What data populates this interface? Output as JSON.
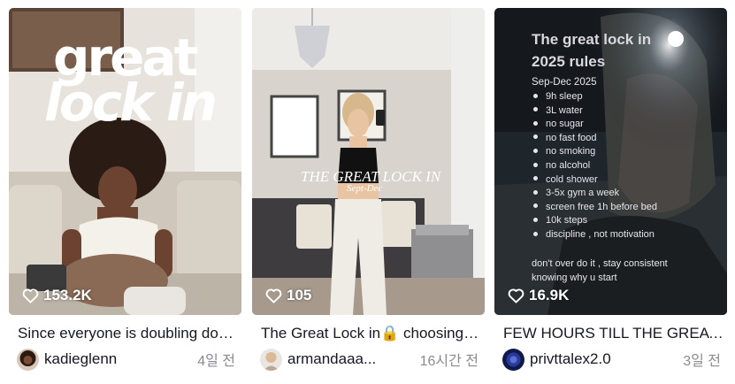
{
  "videos": [
    {
      "likes": "153.2K",
      "title": "Since everyone is doubling down on the great lock in",
      "username": "kadieglenn",
      "time": "4일 전",
      "overlay": {
        "line1": "great",
        "line2": "lock in"
      }
    },
    {
      "likes": "105",
      "title": "The Great Lock in🔒 choosing myself",
      "username": "armandaaa...",
      "time": "16시간 전",
      "overlay": {
        "line1": "THE GREAT LOCK IN",
        "line2": "Sept-Dec"
      }
    },
    {
      "likes": "16.9K",
      "title": "FEW HOURS TILL THE GREAT LOCK IN",
      "username": "privttalex2.0",
      "time": "3일 전",
      "overlay": {
        "heading1": "The great lock in",
        "heading2": "2025 rules",
        "subheading": "Sep-Dec 2025",
        "rules": [
          "9h sleep",
          "3L water",
          "no sugar",
          "no fast food",
          "no smoking",
          "no alcohol",
          "cold shower",
          "3-5x gym a week",
          "screen free 1h before bed",
          "10k steps",
          "discipline , not motivation"
        ],
        "footer1": "don't over do it , stay consistent",
        "footer2": "knowing why u start"
      }
    }
  ],
  "icons": {
    "like": "heart-outline-icon"
  }
}
